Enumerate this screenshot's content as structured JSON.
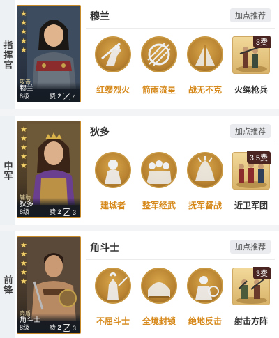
{
  "rows": [
    {
      "role": "指挥官",
      "hero": {
        "name": "穆兰",
        "type": "攻击",
        "card_name": "穆兰",
        "level": "8级",
        "cost_label": "费",
        "cost": "2",
        "tactic_count": "4",
        "stars": 5
      },
      "recommend_label": "加点推荐",
      "skills": [
        {
          "label": "红缨烈火"
        },
        {
          "label": "箭雨流星"
        },
        {
          "label": "战无不克"
        }
      ],
      "troop": {
        "label": "火绳枪兵",
        "cost": "3费"
      }
    },
    {
      "role": "中军",
      "hero": {
        "name": "狄多",
        "type": "辅助",
        "card_name": "狄多",
        "level": "8级",
        "cost_label": "费",
        "cost": "2",
        "tactic_count": "3",
        "stars": 5
      },
      "recommend_label": "加点推荐",
      "skills": [
        {
          "label": "建城者"
        },
        {
          "label": "整军经武"
        },
        {
          "label": "抚军督战"
        }
      ],
      "troop": {
        "label": "近卫军团",
        "cost": "3.5费"
      }
    },
    {
      "role": "前锋",
      "hero": {
        "name": "角斗士",
        "type": "肉盾",
        "card_name": "角斗士",
        "level": "8级",
        "cost_label": "费",
        "cost": "2",
        "tactic_count": "3",
        "stars": 5
      },
      "recommend_label": "加点推荐",
      "skills": [
        {
          "label": "不屈斗士"
        },
        {
          "label": "全境封锁"
        },
        {
          "label": "绝地反击"
        }
      ],
      "troop": {
        "label": "射击方阵",
        "cost": "3费"
      }
    }
  ],
  "colors": {
    "skill_label": "#d6891a",
    "card_border": "#c98c2c",
    "troop_cost_bg": "#4a2420"
  }
}
